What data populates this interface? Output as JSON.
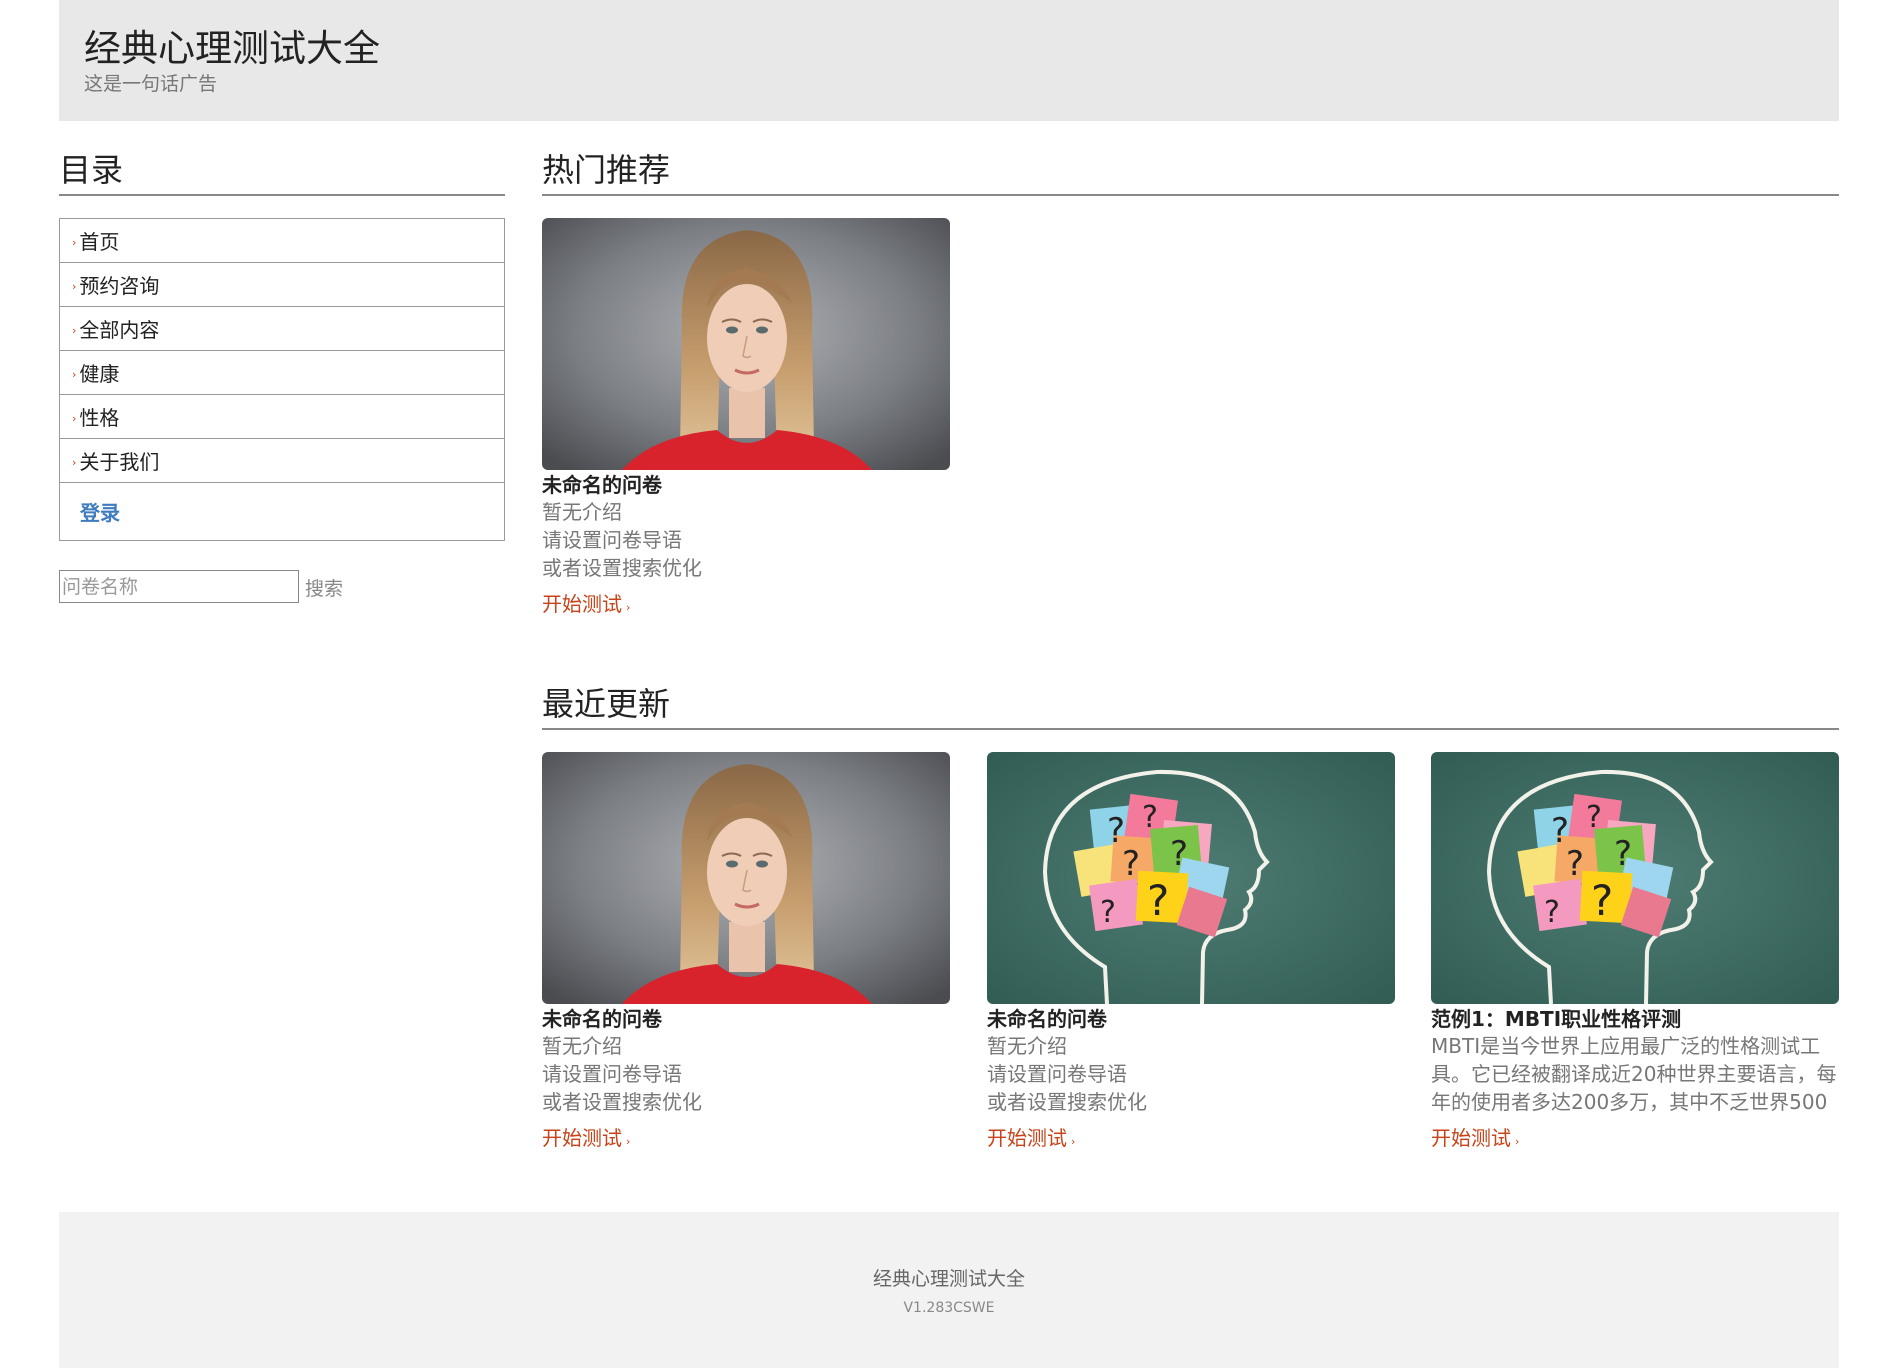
{
  "header": {
    "title": "经典心理测试大全",
    "slogan": "这是一句话广告"
  },
  "sidebar": {
    "title": "目录",
    "items": [
      {
        "label": "首页"
      },
      {
        "label": "预约咨询"
      },
      {
        "label": "全部内容"
      },
      {
        "label": "健康"
      },
      {
        "label": "性格"
      },
      {
        "label": "关于我们"
      }
    ],
    "login_label": "登录",
    "search": {
      "placeholder": "问卷名称",
      "button_label": "搜索"
    }
  },
  "hot": {
    "title": "热门推荐",
    "cards": [
      {
        "image": "woman-portrait",
        "title": "未命名的问卷",
        "lines": [
          "暂无介绍",
          "请设置问卷导语",
          "或者设置搜索优化"
        ],
        "link_label": "开始测试"
      }
    ]
  },
  "recent": {
    "title": "最近更新",
    "cards": [
      {
        "image": "woman-portrait",
        "title": "未命名的问卷",
        "lines": [
          "暂无介绍",
          "请设置问卷导语",
          "或者设置搜索优化"
        ],
        "link_label": "开始测试"
      },
      {
        "image": "head-question-marks",
        "title": "未命名的问卷",
        "lines": [
          "暂无介绍",
          "请设置问卷导语",
          "或者设置搜索优化"
        ],
        "link_label": "开始测试"
      },
      {
        "image": "head-question-marks",
        "title": "范例1：MBTI职业性格评测",
        "lines": [
          "MBTI是当今世界上应用最广泛的性格测试工具。它已经被翻译成近20种世界主要语言，每年的使用者多达200多万，其中不乏世界500"
        ],
        "link_label": "开始测试"
      }
    ]
  },
  "footer": {
    "title": "经典心理测试大全",
    "version": "V1.283CSWE"
  },
  "colors": {
    "accent": "#c8431a",
    "login": "#3e7cc0",
    "header_bg": "#e8e8e8",
    "footer_bg": "#f2f2f2"
  }
}
